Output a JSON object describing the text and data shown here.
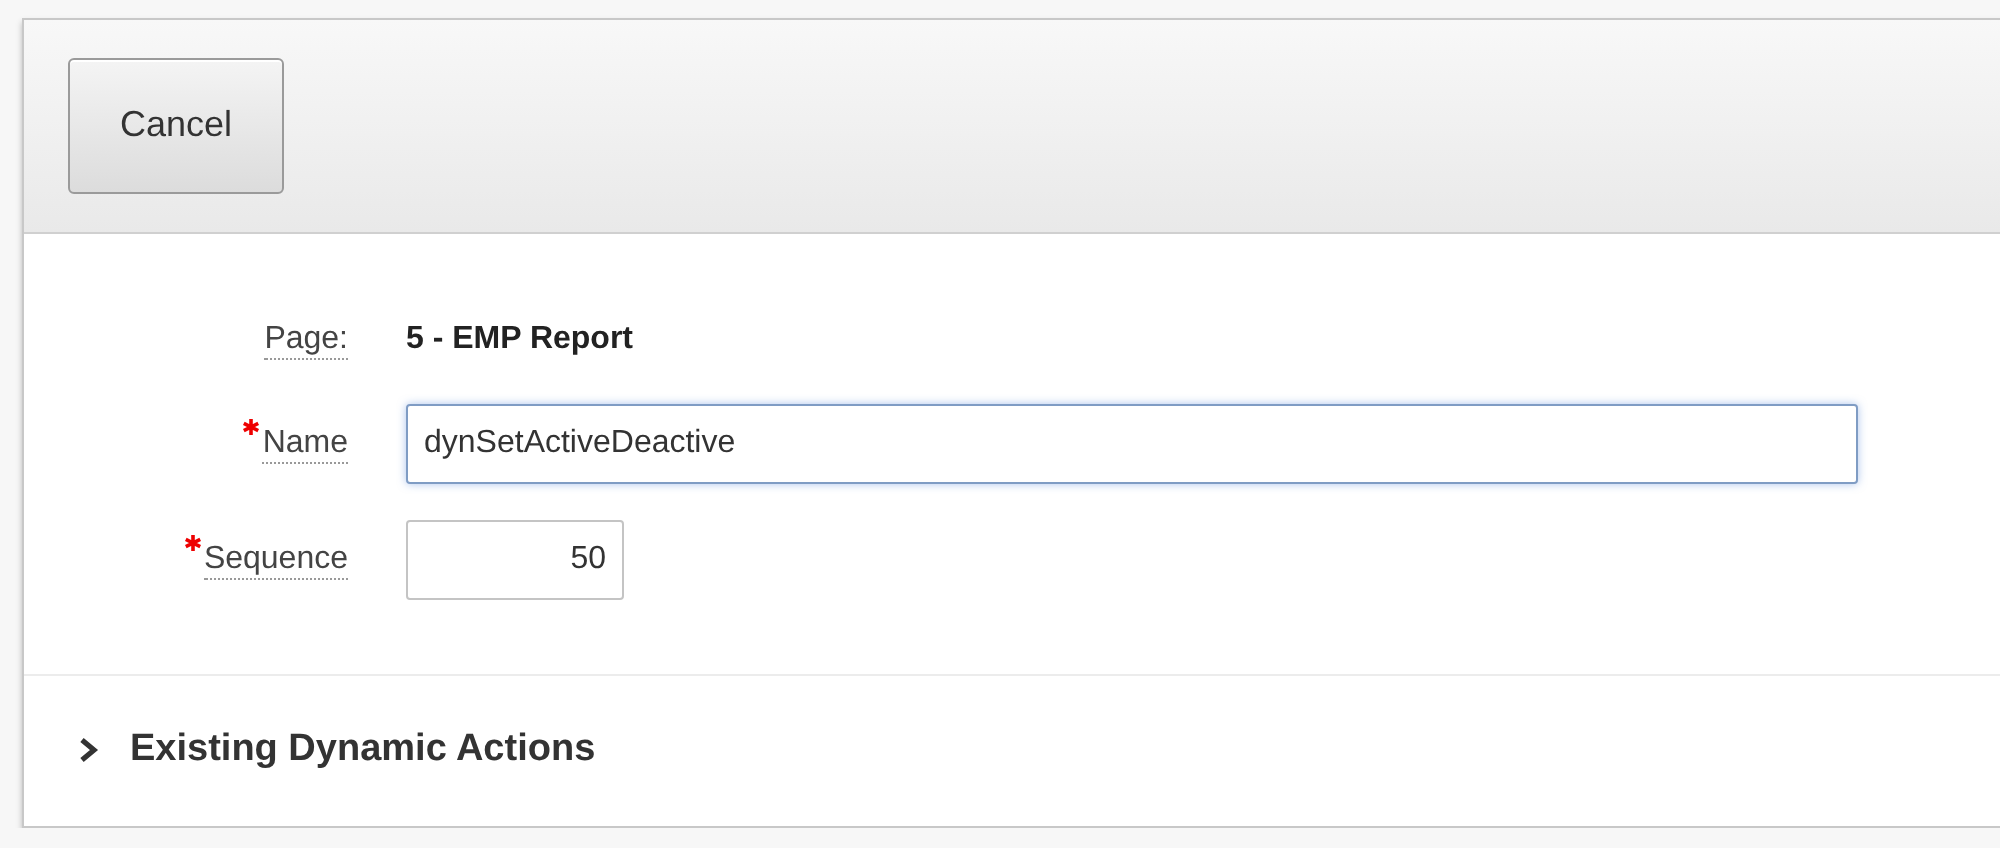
{
  "toolbar": {
    "buttons": [
      {
        "label": "Cancel"
      }
    ]
  },
  "form": {
    "fields": [
      {
        "kind": "display",
        "label": "Page:",
        "value": "5 - EMP Report",
        "required": false
      },
      {
        "kind": "text",
        "label": "Name",
        "value": "dynSetActiveDeactive",
        "required": true,
        "focused": true
      },
      {
        "kind": "number",
        "label": "Sequence",
        "value": "50",
        "required": true,
        "focused": false
      }
    ]
  },
  "section": {
    "title": "Existing Dynamic Actions",
    "expanded": false
  }
}
